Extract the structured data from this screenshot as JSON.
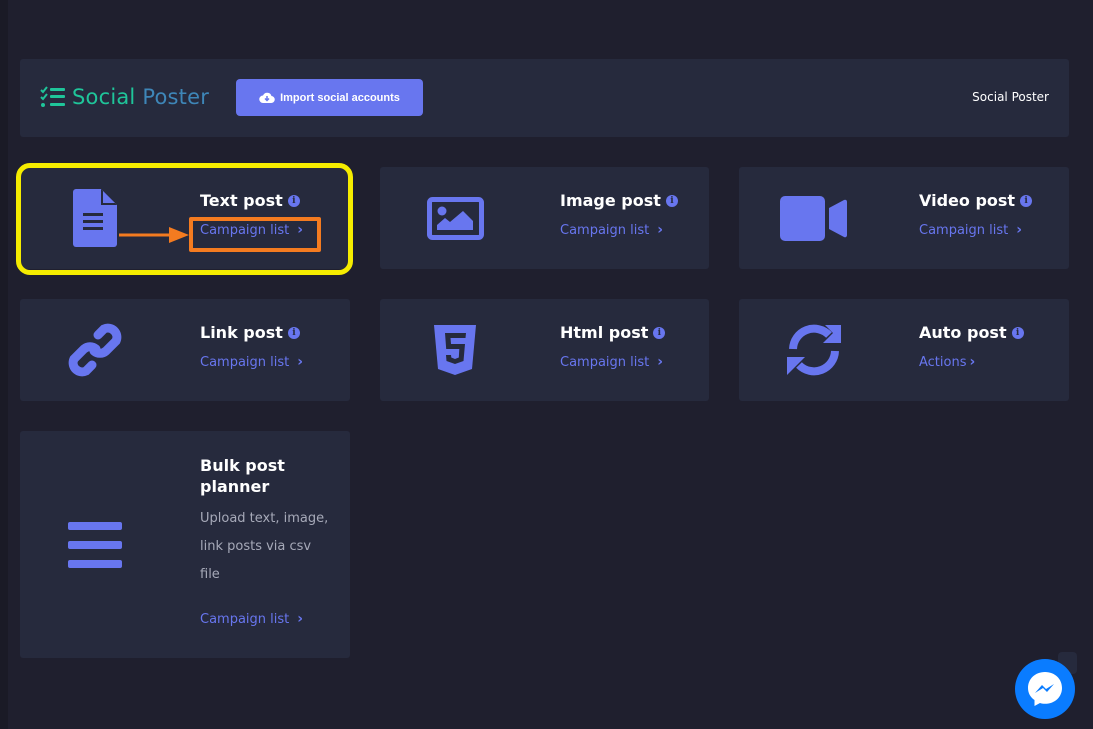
{
  "header": {
    "logo_word1": "Social",
    "logo_word2": "Poster",
    "import_button": "Import social accounts",
    "right_title": "Social Poster"
  },
  "cards": [
    {
      "title": "Text post",
      "link": "Campaign list",
      "icon": "file-text-icon"
    },
    {
      "title": "Image post",
      "link": "Campaign list",
      "icon": "image-icon"
    },
    {
      "title": "Video post",
      "link": "Campaign list",
      "icon": "video-camera-icon"
    },
    {
      "title": "Link post",
      "link": "Campaign list",
      "icon": "link-icon"
    },
    {
      "title": "Html post",
      "link": "Campaign list",
      "icon": "html5-icon"
    },
    {
      "title": "Auto post",
      "link": "Actions",
      "icon": "sync-icon"
    },
    {
      "title": "Bulk post planner",
      "description": "Upload text, image, link posts via csv file",
      "link": "Campaign list",
      "icon": "bars-icon"
    }
  ],
  "info_glyph": "i",
  "chevron_glyph": "›",
  "colors": {
    "accent": "#6876ef",
    "logo_green": "#1fc59a",
    "logo_blue": "#3e86b8",
    "card_bg": "#262a3d",
    "page_bg": "#1f1f2e",
    "highlight_yellow": "#f5ec00",
    "highlight_orange": "#f47b20",
    "messenger_blue": "#0a7cff"
  }
}
